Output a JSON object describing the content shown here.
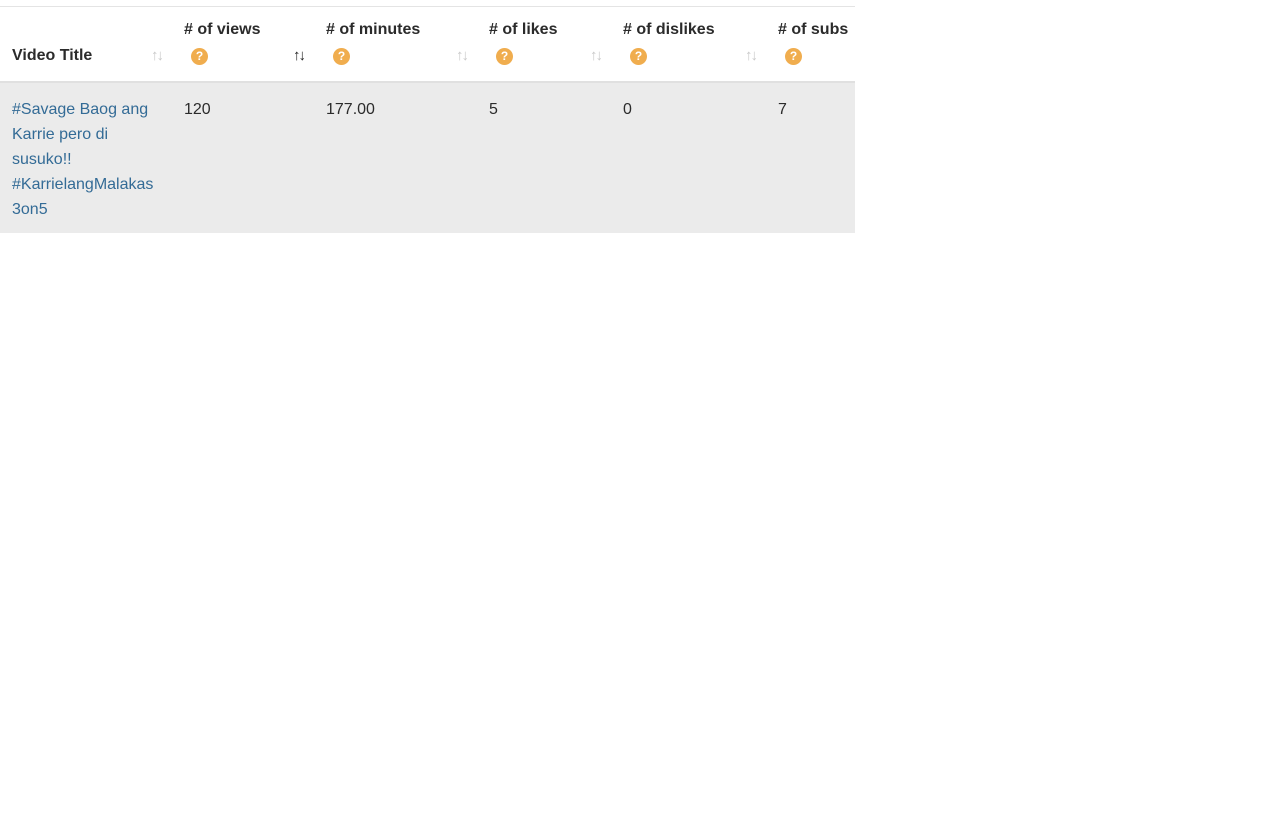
{
  "table": {
    "columns": [
      {
        "label": "Video Title",
        "has_help": false,
        "sort_active": false
      },
      {
        "label": "# of views",
        "has_help": true,
        "sort_active": true
      },
      {
        "label": "# of minutes",
        "has_help": true,
        "sort_active": false
      },
      {
        "label": "# of likes",
        "has_help": true,
        "sort_active": false
      },
      {
        "label": "# of dislikes",
        "has_help": true,
        "sort_active": false
      },
      {
        "label": "# of subs",
        "has_help": true,
        "sort_active": false
      }
    ],
    "help_glyph": "?",
    "sort_glyph_up": "↑",
    "sort_glyph_down": "↓",
    "rows": [
      {
        "title": "#Savage Baog ang Karrie pero di susuko!! #KarrielangMalakas 3on5",
        "views": "120",
        "minutes": "177.00",
        "likes": "5",
        "dislikes": "0",
        "subs": "7"
      }
    ]
  },
  "colors": {
    "help_icon": "#f0ad4e",
    "link": "#336b96",
    "row_background": "#ebebeb"
  }
}
